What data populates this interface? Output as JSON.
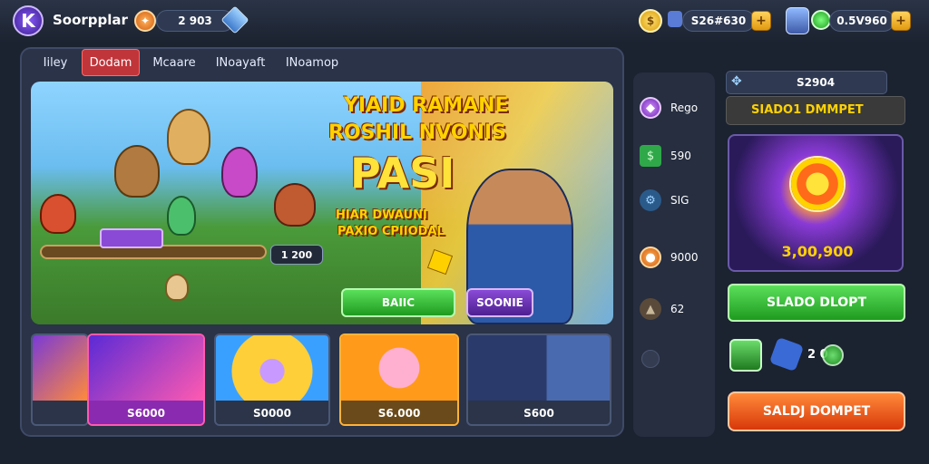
{
  "app": {
    "logo_letter": "K",
    "name": "Soorpplar"
  },
  "top": {
    "left_balance": "2 903",
    "right_balance_1": "S26#630",
    "right_balance_2": "0.5V960"
  },
  "tabs": [
    {
      "label": "Iiley",
      "active": false
    },
    {
      "label": "Dodam",
      "active": true
    },
    {
      "label": "Mcaare",
      "active": false
    },
    {
      "label": "INoayaft",
      "active": false
    },
    {
      "label": "INoamop",
      "active": false
    }
  ],
  "banner": {
    "title_line1": "YIAID RAMANE",
    "title_line2": "ROSHIL NVONIS",
    "title_big": "PASI",
    "subtitle_line1": "HIAR DWAUNI",
    "subtitle_line2": "PAXIO CPIIODAL",
    "counter": "1 200",
    "green_button": "BAIIC",
    "purple_button": "SOONIE"
  },
  "cards": [
    {
      "price": ""
    },
    {
      "price": "S6000"
    },
    {
      "price": "S0000"
    },
    {
      "price": "S6.000"
    },
    {
      "price": "S600"
    }
  ],
  "side_items": [
    {
      "label": "Rego",
      "icon": "gem-icon"
    },
    {
      "label": "590",
      "icon": "cash-icon"
    },
    {
      "label": "SIG",
      "icon": "gear-icon"
    },
    {
      "label": "9000",
      "icon": "coin-icon"
    },
    {
      "label": "62",
      "icon": "bag-icon"
    }
  ],
  "right_panel": {
    "header_value": "S2904",
    "header_title": "SIADO1 DMMPET",
    "prize_amount": "3,00,900",
    "green_button": "SLADO DLOPT",
    "counter": "2 0",
    "orange_button": "SALDJ DOMPET"
  },
  "colors": {
    "accent_green": "#2fc12f",
    "accent_orange": "#ff6a1a",
    "accent_red": "#c0353a",
    "gold": "#ffd200"
  }
}
